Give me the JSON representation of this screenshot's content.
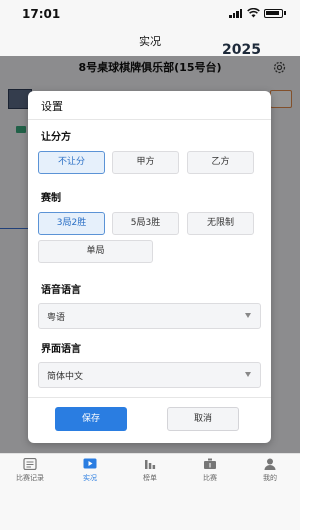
{
  "status_bar": {
    "time": "17:01"
  },
  "nav": {
    "title": "实况"
  },
  "page": {
    "club_name": "8号桌球棋牌俱乐部(15号台)",
    "year_badge": "2025"
  },
  "dialog": {
    "title": "设置",
    "handicap": {
      "label": "让分方",
      "options": [
        "不让分",
        "甲方",
        "乙方"
      ],
      "selected": "不让分"
    },
    "format": {
      "label": "赛制",
      "options": [
        "3局2胜",
        "5局3胜",
        "无限制",
        "单局"
      ],
      "selected": "3局2胜"
    },
    "voice_language": {
      "label": "语音语言",
      "value": "粤语"
    },
    "ui_language": {
      "label": "界面语言",
      "value": "简体中文"
    },
    "save_label": "保存",
    "cancel_label": "取消"
  },
  "tabbar": {
    "items": [
      {
        "label": "比赛记录",
        "icon": "list-icon"
      },
      {
        "label": "实况",
        "icon": "play-icon"
      },
      {
        "label": "榜单",
        "icon": "bar-chart-icon"
      },
      {
        "label": "比赛",
        "icon": "match-icon"
      },
      {
        "label": "我的",
        "icon": "user-icon"
      }
    ],
    "active": "实况"
  },
  "colors": {
    "accent": "#2a7de1",
    "selected_bg": "#e6f0fb"
  }
}
